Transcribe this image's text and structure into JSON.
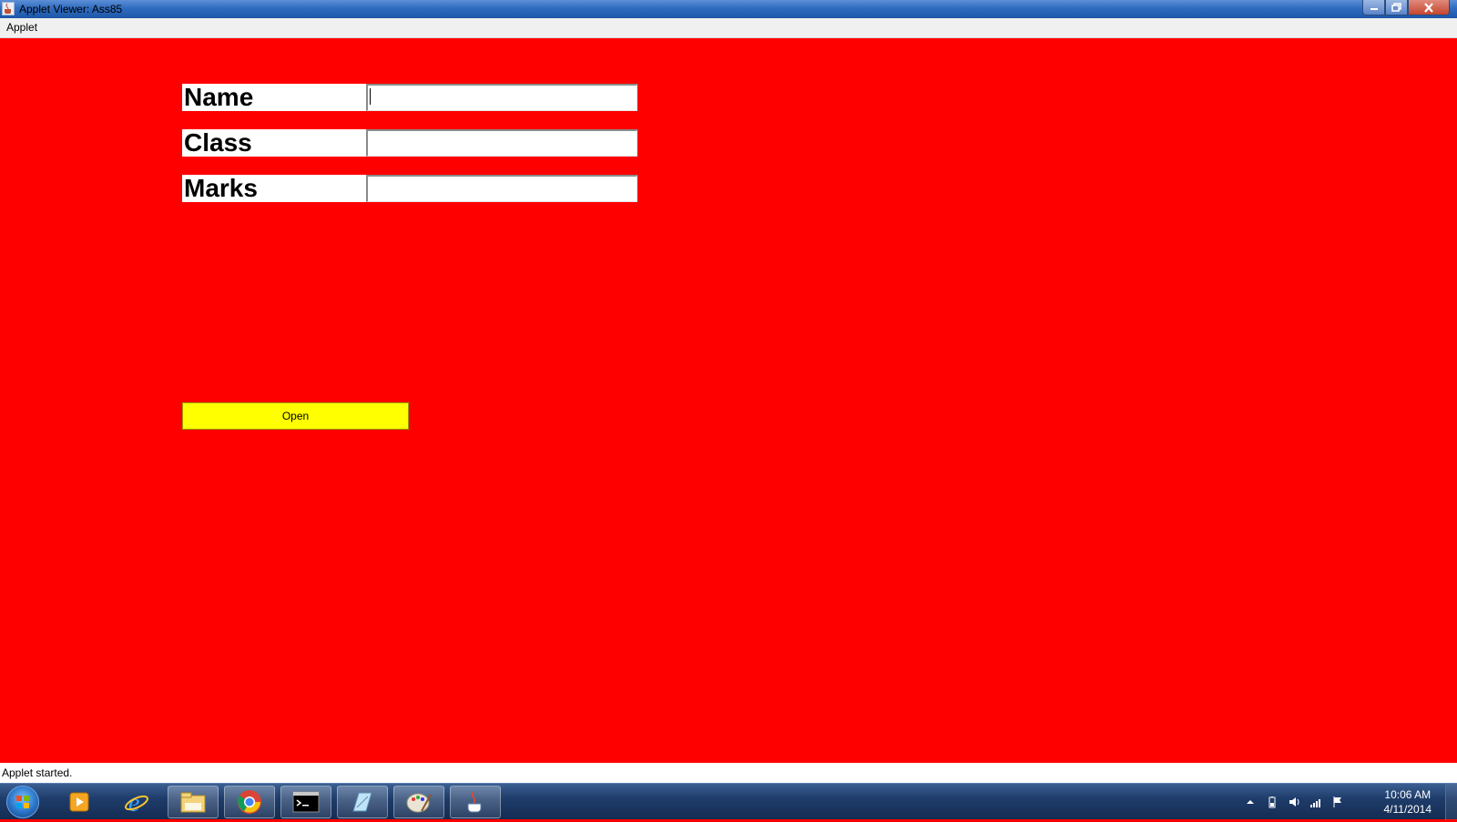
{
  "window": {
    "title": "Applet Viewer: Ass85",
    "icon": "java-cup-icon"
  },
  "menubar": {
    "items": [
      {
        "label": "Applet"
      }
    ]
  },
  "form": {
    "fields": [
      {
        "label": "Name",
        "value": ""
      },
      {
        "label": "Class",
        "value": ""
      },
      {
        "label": "Marks",
        "value": ""
      }
    ],
    "open_button": "Open"
  },
  "colors": {
    "applet_background": "#ff0000",
    "button_background": "#ffff00"
  },
  "statusbar": {
    "text": "Applet started."
  },
  "taskbar": {
    "items": [
      {
        "name": "windows-media-player-icon"
      },
      {
        "name": "internet-explorer-icon"
      },
      {
        "name": "windows-explorer-icon"
      },
      {
        "name": "chrome-icon"
      },
      {
        "name": "command-prompt-icon"
      },
      {
        "name": "notepad-icon"
      },
      {
        "name": "paint-icon"
      },
      {
        "name": "java-applet-icon"
      }
    ],
    "clock": {
      "time": "10:06 AM",
      "date": "4/11/2014"
    }
  }
}
